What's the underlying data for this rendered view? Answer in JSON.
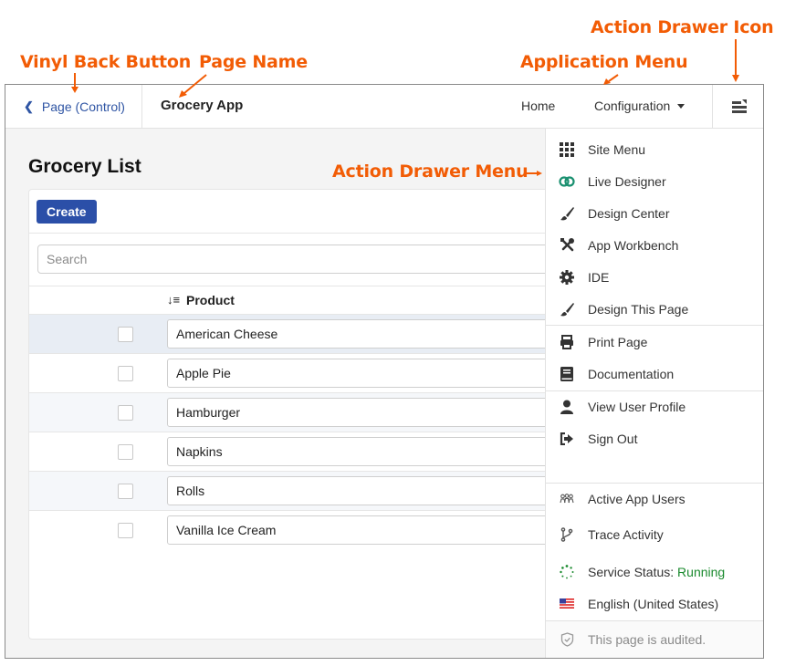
{
  "annotations": {
    "back_button": "Vinyl Back Button",
    "page_name": "Page Name",
    "app_menu": "Application Menu",
    "drawer_icon": "Action Drawer Icon",
    "drawer_menu": "Action Drawer Menu"
  },
  "topbar": {
    "back_label": "Page (Control)",
    "page_name": "Grocery App",
    "nav": [
      {
        "label": "Home"
      },
      {
        "label": "Configuration"
      }
    ],
    "drawer_icon": "action-drawer-icon"
  },
  "content": {
    "title": "Grocery List",
    "create_label": "Create",
    "search_placeholder": "Search",
    "search_value": "",
    "column_header": "Product",
    "sort_icon": "sort-alpha-down-icon",
    "rows": [
      {
        "product": "American Cheese",
        "checked": false
      },
      {
        "product": "Apple Pie",
        "checked": false
      },
      {
        "product": "Hamburger",
        "checked": false
      },
      {
        "product": "Napkins",
        "checked": false
      },
      {
        "product": "Rolls",
        "checked": false
      },
      {
        "product": "Vanilla Ice Cream",
        "checked": false
      }
    ]
  },
  "drawer": {
    "items": [
      {
        "label": "Site Menu",
        "icon": "grid-icon"
      },
      {
        "label": "Live Designer",
        "icon": "toggle-icon"
      },
      {
        "label": "Design Center",
        "icon": "brush-icon"
      },
      {
        "label": "App Workbench",
        "icon": "tools-icon"
      },
      {
        "label": "IDE",
        "icon": "gear-icon"
      },
      {
        "label": "Design This Page",
        "icon": "brush-icon"
      },
      {
        "label": "Print Page",
        "icon": "print-icon"
      },
      {
        "label": "Documentation",
        "icon": "book-icon"
      },
      {
        "label": "View User Profile",
        "icon": "user-icon"
      },
      {
        "label": "Sign Out",
        "icon": "sign-out-icon"
      },
      {
        "label": "Active App Users",
        "icon": "users-icon"
      },
      {
        "label": "Trace Activity",
        "icon": "branch-icon"
      },
      {
        "label": "Service Status: ",
        "status": "Running",
        "icon": "spinner-icon"
      },
      {
        "label": "English (United States)",
        "icon": "us-flag-icon"
      }
    ],
    "audit_text": "This page is audited."
  },
  "colors": {
    "accent": "#2b4fa8",
    "link": "#2f55a4",
    "annotation": "#f25c05",
    "status_running": "#1a8a2e",
    "live_designer": "#1a9070"
  }
}
